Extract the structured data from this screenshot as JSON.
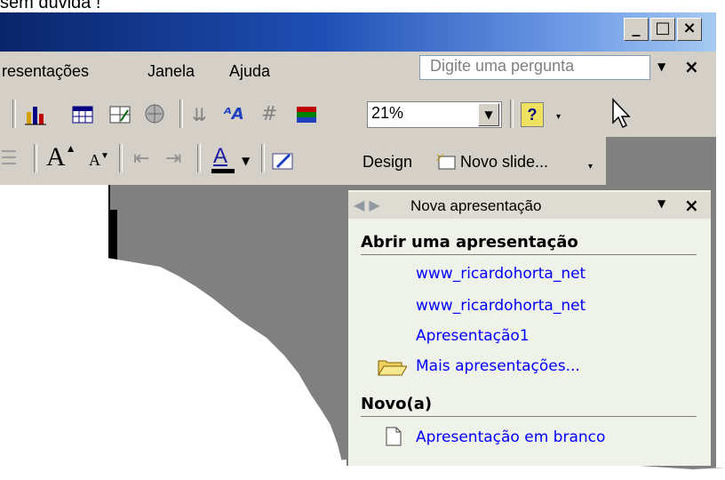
{
  "clip_text": "sem dúvida !",
  "window": {
    "buttons": {
      "minimize": "_",
      "maximize": "□",
      "close": "×"
    }
  },
  "menu": {
    "items": [
      "resentações",
      "Janela",
      "Ajuda"
    ],
    "ask_placeholder": "Digite uma pergunta"
  },
  "toolbar": {
    "zoom": "21%",
    "help": "?",
    "design_label": "Design",
    "novo_slide_label": "Novo slide...",
    "font_grow": "A",
    "font_shrink": "A",
    "font_color_letter": "A"
  },
  "task_pane": {
    "title": "Nova apresentação",
    "sections": [
      {
        "title": "Abrir uma apresentação",
        "links": [
          "www_ricardohorta_net",
          "www_ricardohorta_net",
          "Apresentação1",
          "Mais apresentações..."
        ]
      },
      {
        "title": "Novo(a)",
        "links": [
          "Apresentação em branco"
        ]
      }
    ]
  },
  "colors": {
    "title_start": "#0a246a",
    "title_end": "#a6caf0",
    "face": "#d4d0c8",
    "pane_bg": "#eef2e8",
    "link": "#0000ff"
  }
}
